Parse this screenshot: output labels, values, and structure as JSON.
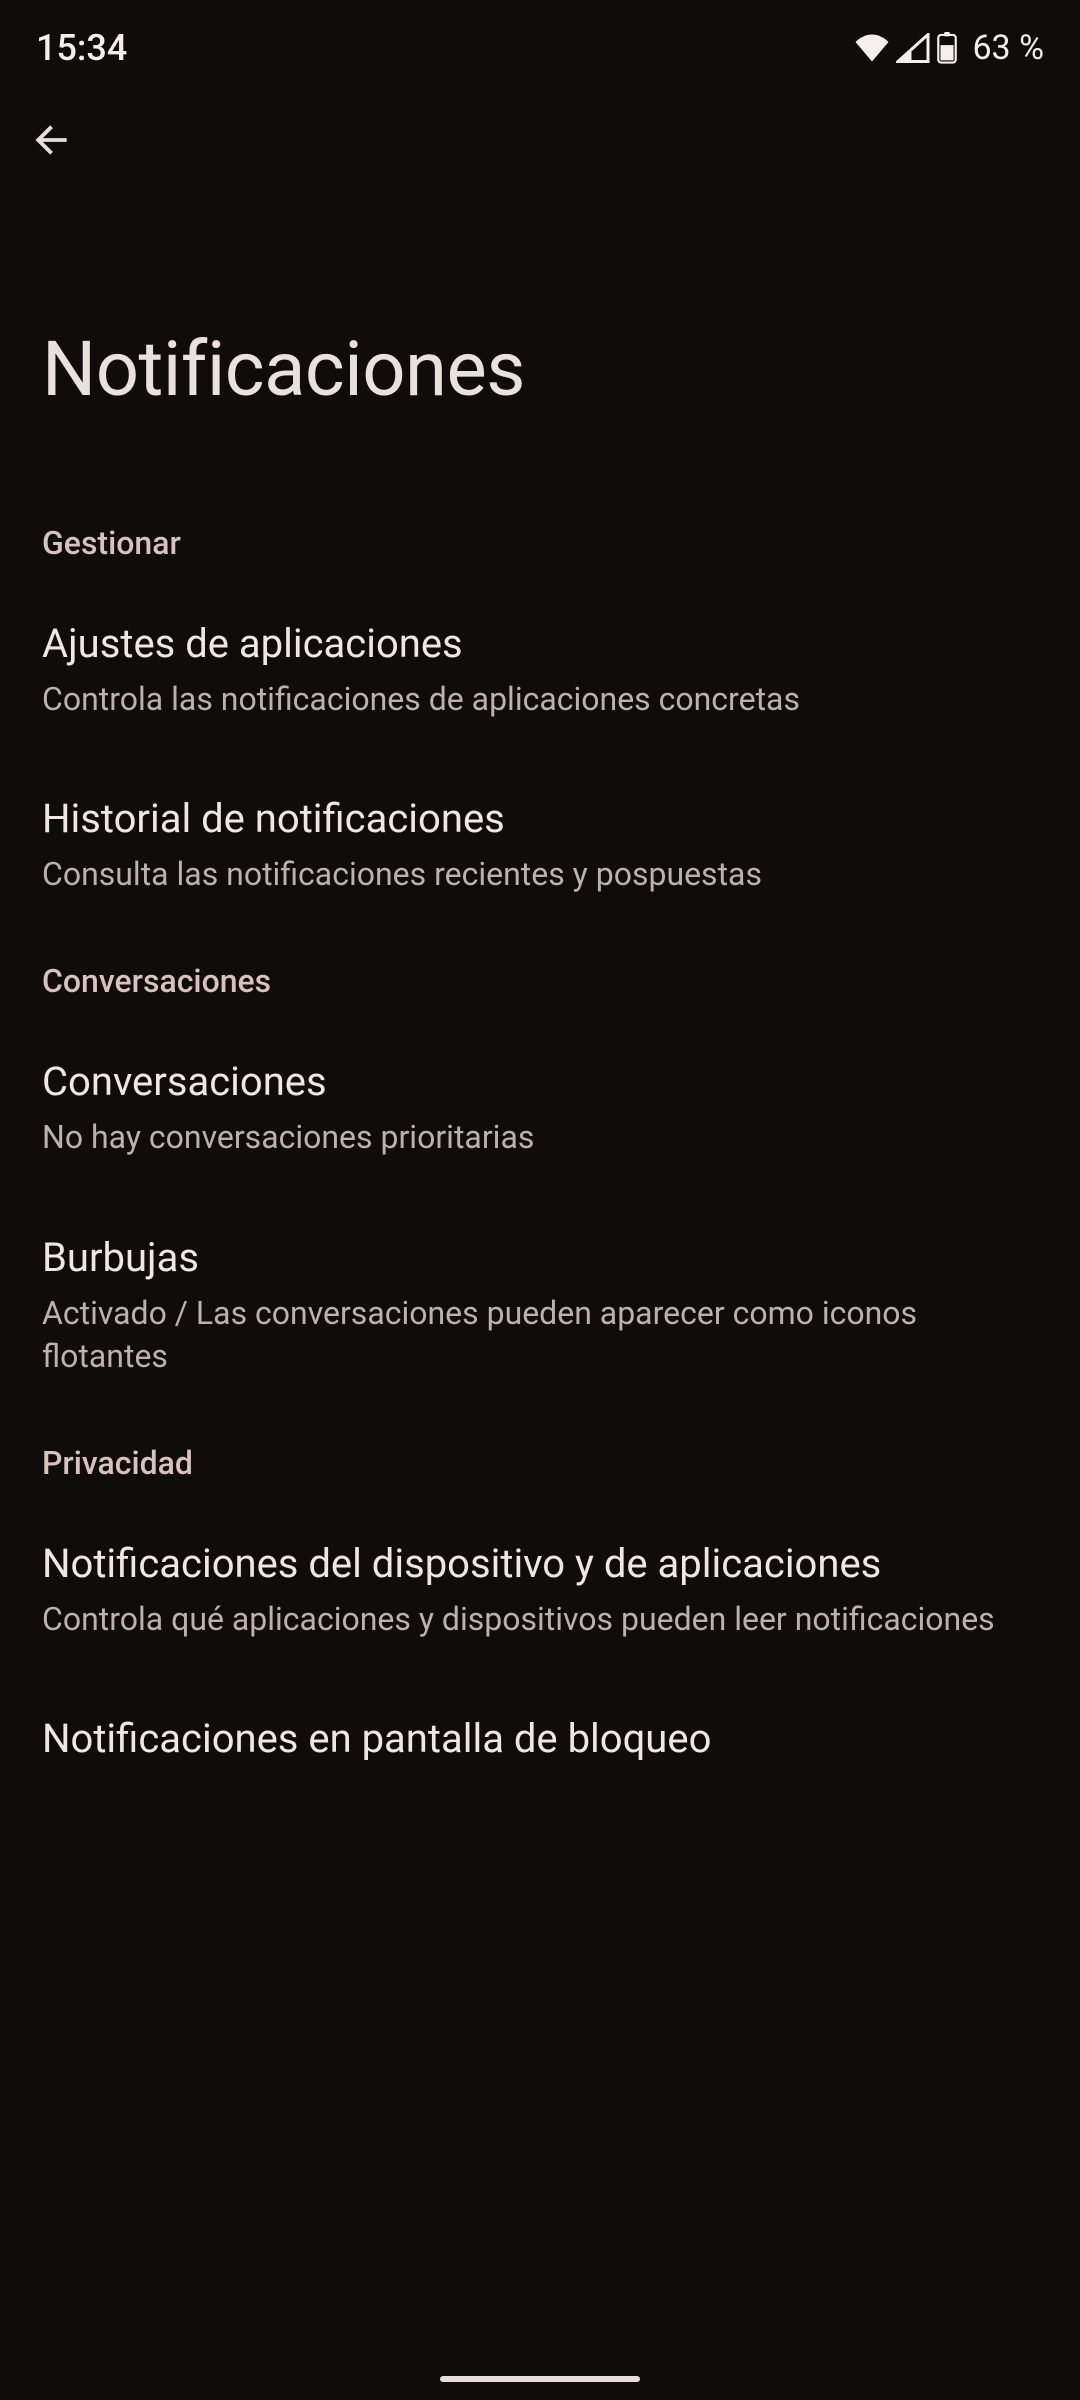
{
  "status_bar": {
    "time": "15:34",
    "battery": "63 %"
  },
  "header": {
    "title": "Notificaciones"
  },
  "sections": [
    {
      "header": "Gestionar",
      "items": [
        {
          "title": "Ajustes de aplicaciones",
          "subtitle": "Controla las notificaciones de aplicaciones concretas"
        },
        {
          "title": "Historial de notificaciones",
          "subtitle": "Consulta las notificaciones recientes y pospuestas"
        }
      ]
    },
    {
      "header": "Conversaciones",
      "items": [
        {
          "title": "Conversaciones",
          "subtitle": "No hay conversaciones prioritarias"
        },
        {
          "title": "Burbujas",
          "subtitle": "Activado / Las conversaciones pueden aparecer como iconos flotantes"
        }
      ]
    },
    {
      "header": "Privacidad",
      "items": [
        {
          "title": "Notificaciones del dispositivo y de aplicaciones",
          "subtitle": "Controla qué aplicaciones y dispositivos pueden leer notificaciones"
        },
        {
          "title": "Notificaciones en pantalla de bloqueo",
          "subtitle": ""
        }
      ]
    }
  ]
}
